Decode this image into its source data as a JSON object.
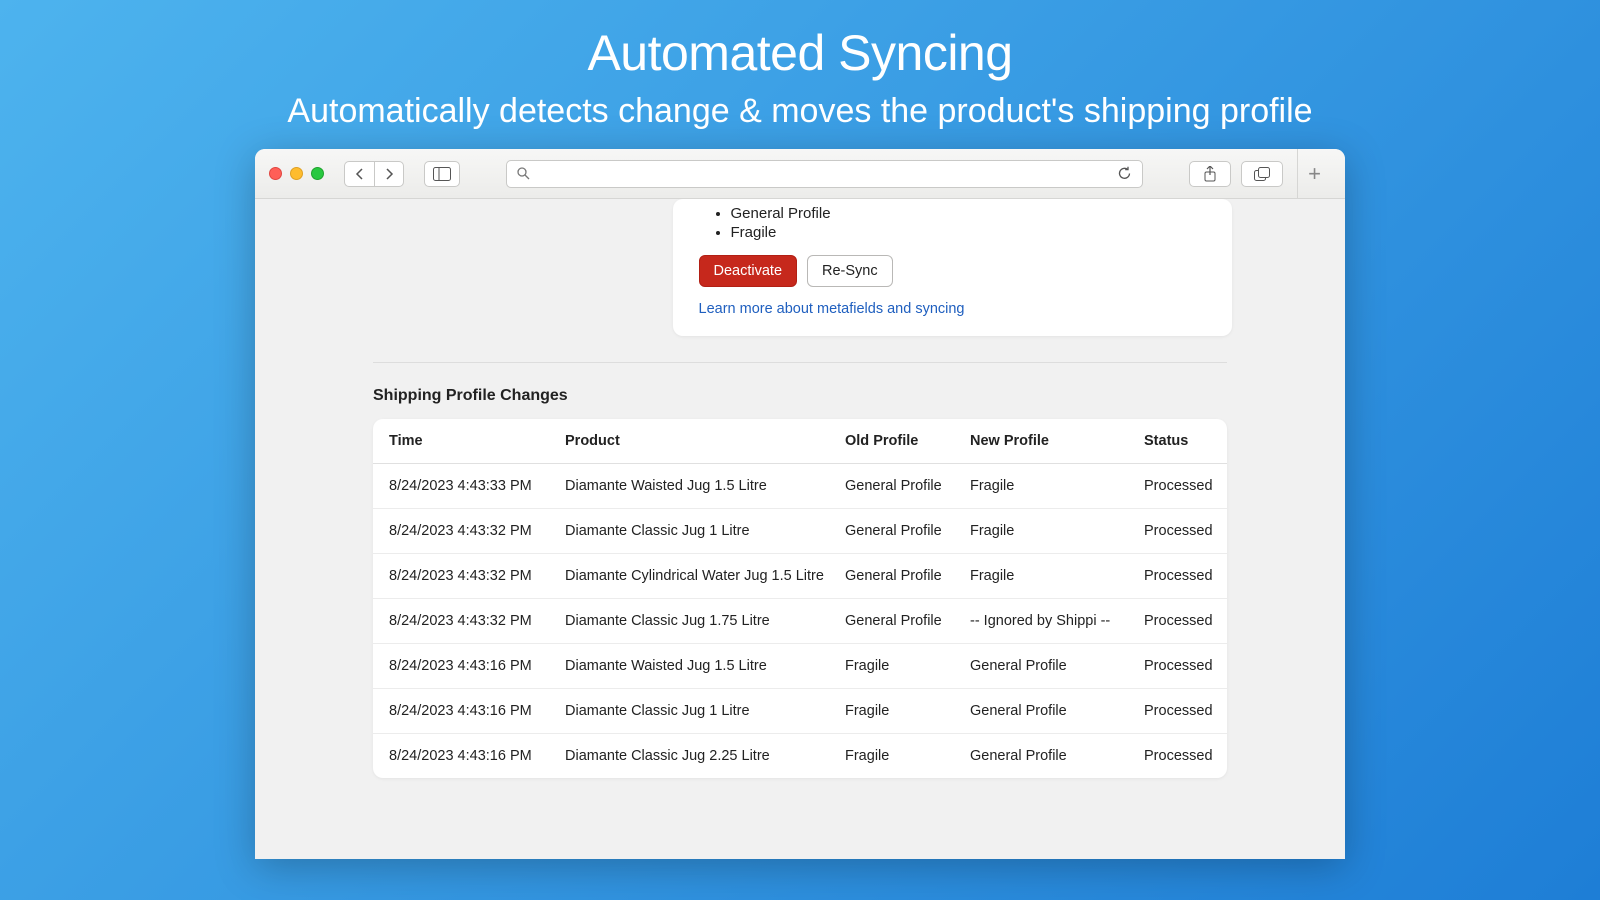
{
  "hero": {
    "title": "Automated Syncing",
    "subtitle": "Automatically detects change & moves the product's shipping profile"
  },
  "card": {
    "profiles": [
      "General Profile",
      "Fragile"
    ],
    "deactivate_label": "Deactivate",
    "resync_label": "Re-Sync",
    "link_label": "Learn more about metafields and syncing"
  },
  "section_title": "Shipping Profile Changes",
  "table": {
    "headers": {
      "time": "Time",
      "product": "Product",
      "old_profile": "Old Profile",
      "new_profile": "New Profile",
      "status": "Status"
    },
    "rows": [
      {
        "time": "8/24/2023 4:43:33 PM",
        "product": "Diamante Waisted Jug 1.5 Litre",
        "old": "General Profile",
        "new": "Fragile",
        "status": "Processed"
      },
      {
        "time": "8/24/2023 4:43:32 PM",
        "product": "Diamante Classic Jug 1 Litre",
        "old": "General Profile",
        "new": "Fragile",
        "status": "Processed"
      },
      {
        "time": "8/24/2023 4:43:32 PM",
        "product": "Diamante Cylindrical Water Jug 1.5 Litre",
        "old": "General Profile",
        "new": "Fragile",
        "status": "Processed"
      },
      {
        "time": "8/24/2023 4:43:32 PM",
        "product": "Diamante Classic Jug 1.75 Litre",
        "old": "General Profile",
        "new": "-- Ignored by Shippi --",
        "status": "Processed"
      },
      {
        "time": "8/24/2023 4:43:16 PM",
        "product": "Diamante Waisted Jug 1.5 Litre",
        "old": "Fragile",
        "new": "General Profile",
        "status": "Processed"
      },
      {
        "time": "8/24/2023 4:43:16 PM",
        "product": "Diamante Classic Jug 1 Litre",
        "old": "Fragile",
        "new": "General Profile",
        "status": "Processed"
      },
      {
        "time": "8/24/2023 4:43:16 PM",
        "product": "Diamante Classic Jug 2.25 Litre",
        "old": "Fragile",
        "new": "General Profile",
        "status": "Processed"
      }
    ]
  }
}
